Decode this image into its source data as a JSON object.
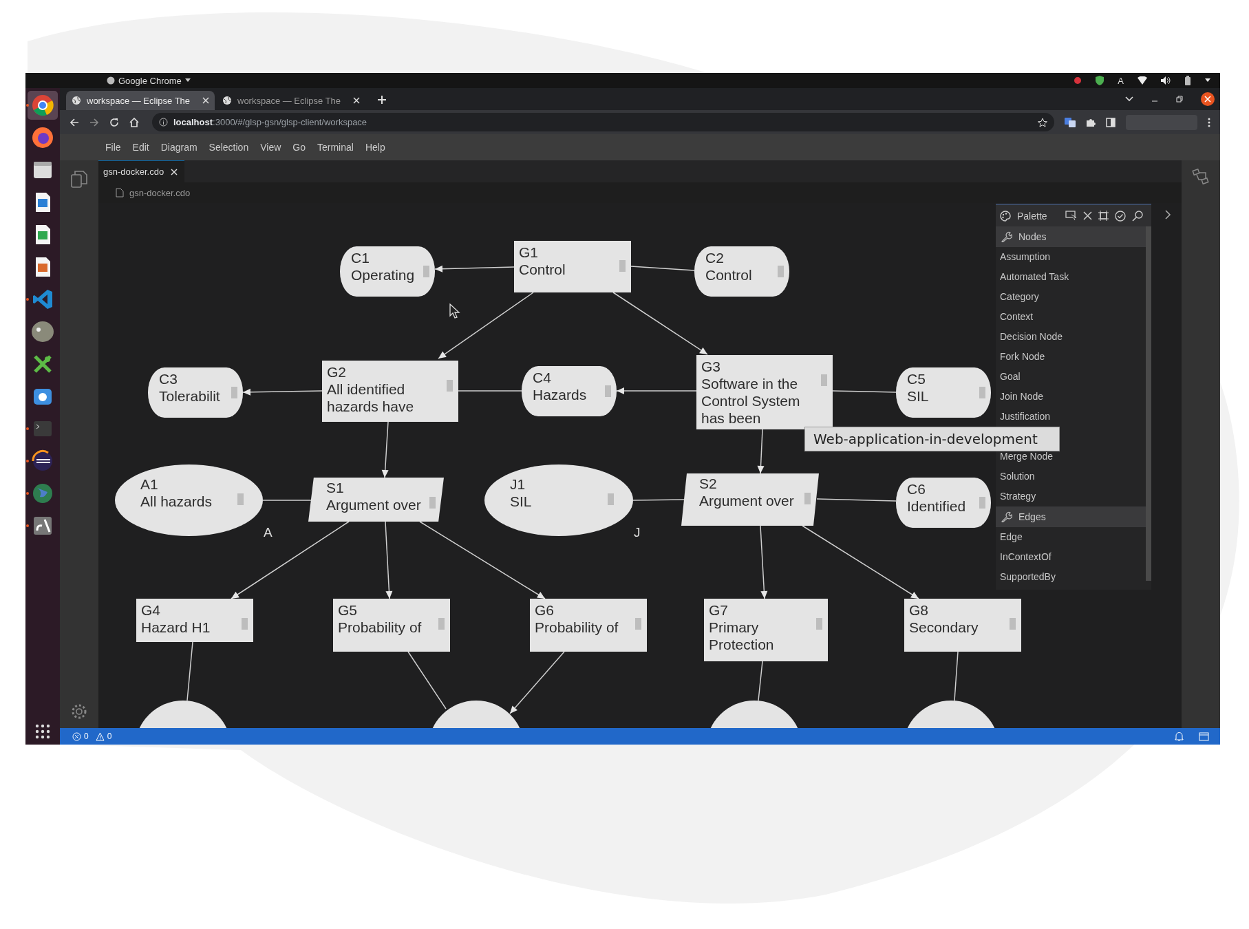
{
  "system_bar": {
    "app_menu": "Google Chrome",
    "keyboard": "A"
  },
  "dock": [
    {
      "kind": "chrome",
      "selected": true,
      "running": true
    },
    {
      "kind": "firefox",
      "selected": false,
      "running": false
    },
    {
      "kind": "files",
      "selected": false,
      "running": false
    },
    {
      "kind": "writer",
      "selected": false,
      "running": false
    },
    {
      "kind": "calc",
      "selected": false,
      "running": false
    },
    {
      "kind": "impress",
      "selected": false,
      "running": false
    },
    {
      "kind": "vscode",
      "selected": false,
      "running": true
    },
    {
      "kind": "gimp",
      "selected": false,
      "running": false
    },
    {
      "kind": "xcross",
      "selected": false,
      "running": false
    },
    {
      "kind": "camera",
      "selected": false,
      "running": false
    },
    {
      "kind": "terminal",
      "selected": false,
      "running": true
    },
    {
      "kind": "eclipse",
      "selected": false,
      "running": true
    },
    {
      "kind": "globe",
      "selected": false,
      "running": true
    },
    {
      "kind": "glyph",
      "selected": false,
      "running": true
    }
  ],
  "browser": {
    "tabs": [
      {
        "title": "workspace — Eclipse The",
        "selected": true
      },
      {
        "title": "workspace — Eclipse The",
        "selected": false
      }
    ],
    "url": "**localhost**:3000/#/glsp-gsn/glsp-client/workspace"
  },
  "menu": [
    "File",
    "Edit",
    "Diagram",
    "Selection",
    "View",
    "Go",
    "Terminal",
    "Help"
  ],
  "editor_tabs": [
    {
      "title": "gsn-docker.cdo",
      "selected": true
    }
  ],
  "breadcrumb": "gsn-docker.cdo",
  "nodes": [
    {
      "kind": "context",
      "id": "C1",
      "lines": [
        "Operating"
      ]
    },
    {
      "kind": "goal",
      "id": "G1",
      "lines": [
        "Control"
      ]
    },
    {
      "kind": "context",
      "id": "C2",
      "lines": [
        "Control"
      ]
    },
    {
      "kind": "context",
      "id": "C3",
      "lines": [
        "Tolerabilit"
      ]
    },
    {
      "kind": "goal",
      "id": "G2",
      "lines": [
        "All identified",
        "hazards have"
      ]
    },
    {
      "kind": "context",
      "id": "C4",
      "lines": [
        "Hazards"
      ]
    },
    {
      "kind": "goal",
      "id": "G3",
      "lines": [
        "Software in the",
        "Control System",
        "has been"
      ]
    },
    {
      "kind": "context",
      "id": "C5",
      "lines": [
        "SIL"
      ]
    },
    {
      "kind": "assumption",
      "id": "A1",
      "lines": [
        "All hazards"
      ],
      "marker": "A"
    },
    {
      "kind": "strategy",
      "id": "S1",
      "lines": [
        "Argument over"
      ]
    },
    {
      "kind": "justification",
      "id": "J1",
      "lines": [
        "SIL"
      ],
      "marker": "J"
    },
    {
      "kind": "strategy",
      "id": "S2",
      "lines": [
        "Argument over"
      ]
    },
    {
      "kind": "context",
      "id": "C6",
      "lines": [
        "Identified"
      ]
    },
    {
      "kind": "goal",
      "id": "G4",
      "lines": [
        "Hazard H1"
      ]
    },
    {
      "kind": "goal",
      "id": "G5",
      "lines": [
        "Probability of"
      ]
    },
    {
      "kind": "goal",
      "id": "G6",
      "lines": [
        "Probability of"
      ]
    },
    {
      "kind": "goal",
      "id": "G7",
      "lines": [
        "Primary",
        "Protection"
      ]
    },
    {
      "kind": "goal",
      "id": "G8",
      "lines": [
        "Secondary"
      ]
    },
    {
      "kind": "solution"
    },
    {
      "kind": "solution"
    },
    {
      "kind": "solution"
    },
    {
      "kind": "solution"
    }
  ],
  "palette": {
    "title": "Palette",
    "sections": [
      {
        "title": "Nodes",
        "items": [
          {
            "label": "Assumption"
          },
          {
            "label": "Automated Task"
          },
          {
            "label": "Category"
          },
          {
            "label": "Context"
          },
          {
            "label": "Decision Node"
          },
          {
            "label": "Fork Node"
          },
          {
            "label": "Goal"
          },
          {
            "label": "Join Node"
          },
          {
            "label": "Justification"
          },
          {
            "label": "Merge Node",
            "gap_before": true
          },
          {
            "label": "Solution"
          },
          {
            "label": "Strategy"
          }
        ]
      },
      {
        "title": "Edges",
        "items": [
          {
            "label": "Edge"
          },
          {
            "label": "InContextOf"
          },
          {
            "label": "SupportedBy"
          }
        ]
      }
    ]
  },
  "tooltip": "Web-application-in-development",
  "status_bar": {
    "errors": "0",
    "warnings": "0"
  }
}
